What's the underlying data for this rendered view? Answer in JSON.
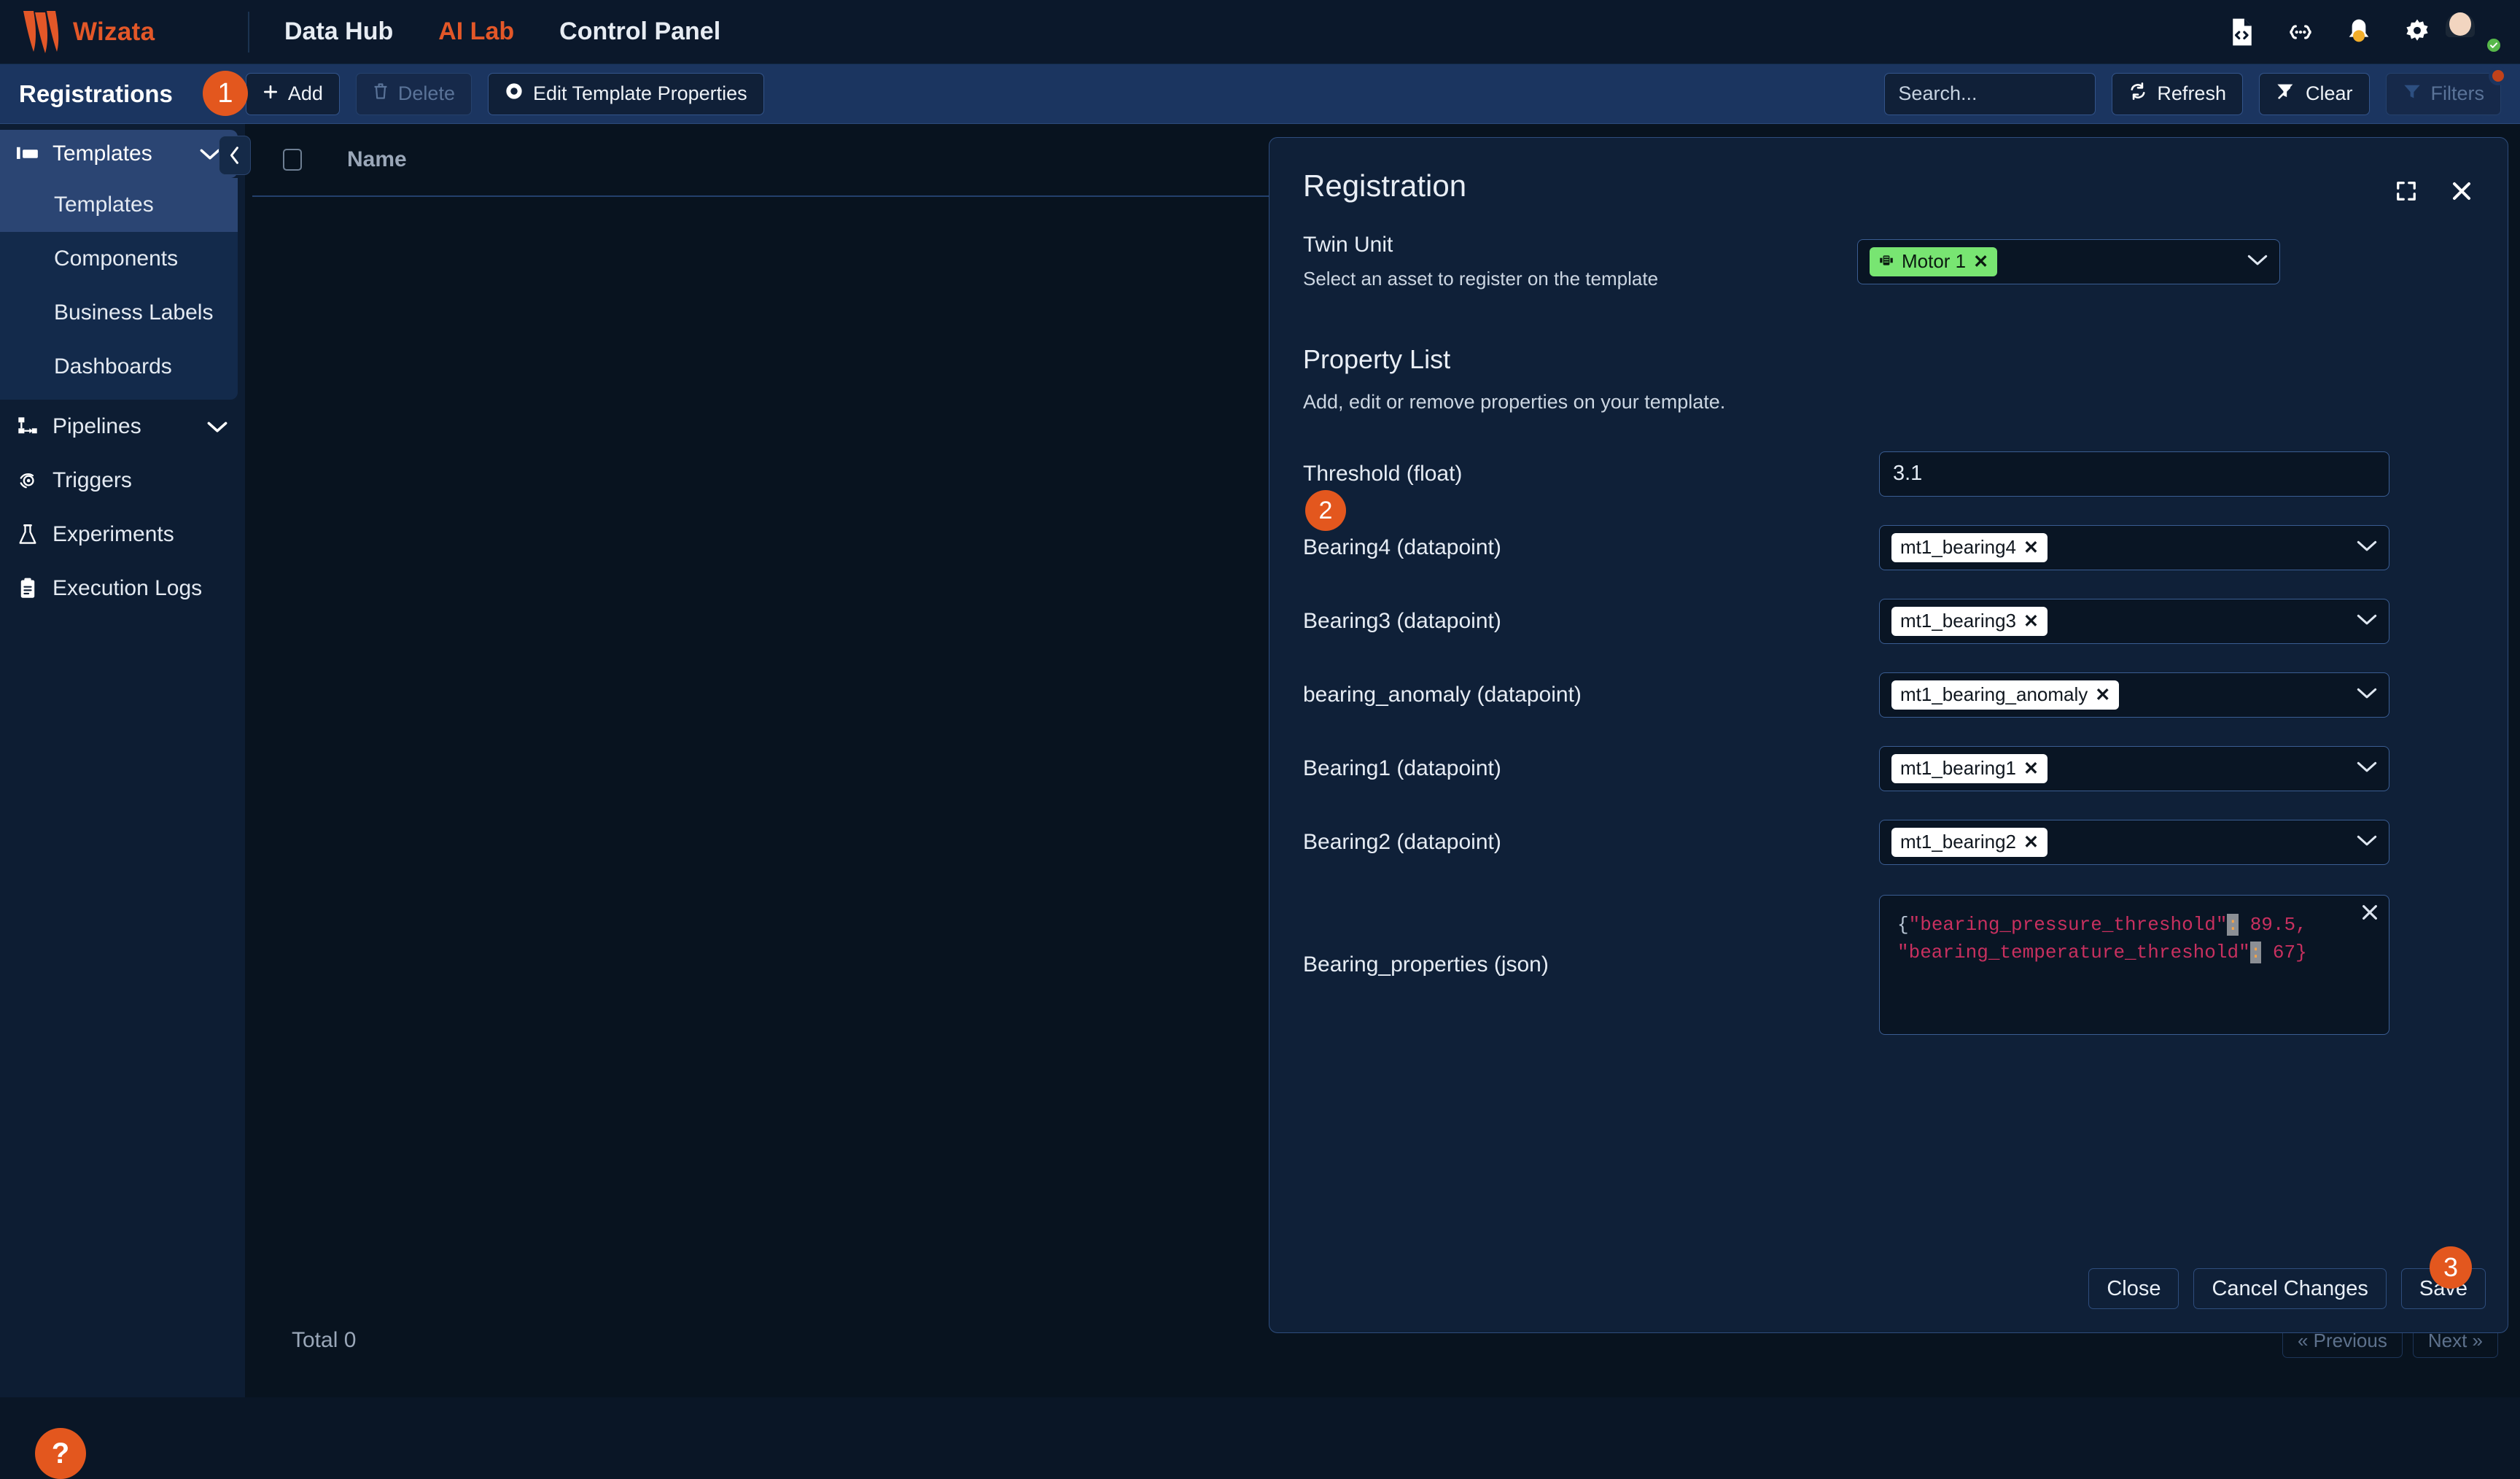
{
  "topnav": {
    "brand": "Wizata",
    "items": [
      {
        "label": "Data Hub",
        "active": false
      },
      {
        "label": "AI Lab",
        "active": true
      },
      {
        "label": "Control Panel",
        "active": false
      }
    ],
    "icons": [
      "code-file-icon",
      "json-braces-icon",
      "bell-icon",
      "gear-icon"
    ],
    "accent": "#e35728"
  },
  "subheader": {
    "title": "Registrations",
    "badge_1": "1",
    "add_label": "Add",
    "delete_label": "Delete",
    "edit_template_label": "Edit Template Properties",
    "search_placeholder": "Search...",
    "refresh_label": "Refresh",
    "clear_label": "Clear",
    "filters_label": "Filters"
  },
  "sidebar": {
    "group": {
      "label": "Templates",
      "icon": "templates-icon"
    },
    "subitems": [
      {
        "label": "Templates",
        "active": true
      },
      {
        "label": "Components",
        "active": false
      },
      {
        "label": "Business Labels",
        "active": false
      },
      {
        "label": "Dashboards",
        "active": false
      }
    ],
    "items": [
      {
        "label": "Pipelines",
        "icon": "pipelines-icon",
        "chevron": true
      },
      {
        "label": "Triggers",
        "icon": "triggers-icon",
        "chevron": false
      },
      {
        "label": "Experiments",
        "icon": "experiments-icon",
        "chevron": false
      },
      {
        "label": "Execution Logs",
        "icon": "execution-logs-icon",
        "chevron": false
      }
    ],
    "help_label": "?"
  },
  "table": {
    "column_name": "Name",
    "total": "Total 0",
    "previous_label": "« Previous",
    "next_label": "Next »"
  },
  "modal": {
    "title": "Registration",
    "twin_unit": {
      "label": "Twin Unit",
      "sublabel": "Select an asset to register on the template",
      "chip": "Motor 1",
      "chip_color": "#78e572",
      "chip_remove": "✕"
    },
    "property_list": {
      "title": "Property List",
      "subtitle": "Add, edit or remove properties on your template.",
      "badge_2": "2"
    },
    "properties": [
      {
        "label": "Threshold (float)",
        "type": "number",
        "value": "3.1"
      },
      {
        "label": "Bearing4 (datapoint)",
        "type": "select",
        "chip": "mt1_bearing4"
      },
      {
        "label": "Bearing3 (datapoint)",
        "type": "select",
        "chip": "mt1_bearing3"
      },
      {
        "label": "bearing_anomaly (datapoint)",
        "type": "select",
        "chip": "mt1_bearing_anomaly"
      },
      {
        "label": "Bearing1 (datapoint)",
        "type": "select",
        "chip": "mt1_bearing1"
      },
      {
        "label": "Bearing2 (datapoint)",
        "type": "select",
        "chip": "mt1_bearing2"
      }
    ],
    "json_property": {
      "label": "Bearing_properties (json)",
      "key1": "\"bearing_pressure_threshold\"",
      "val1": " 89.5,",
      "key2": "\"bearing_temperature_threshold\"",
      "val2": " 67}",
      "open_brace": "{",
      "colon": ":"
    },
    "footer": {
      "close_label": "Close",
      "cancel_label": "Cancel Changes",
      "save_label": "Save",
      "badge_3": "3"
    }
  }
}
